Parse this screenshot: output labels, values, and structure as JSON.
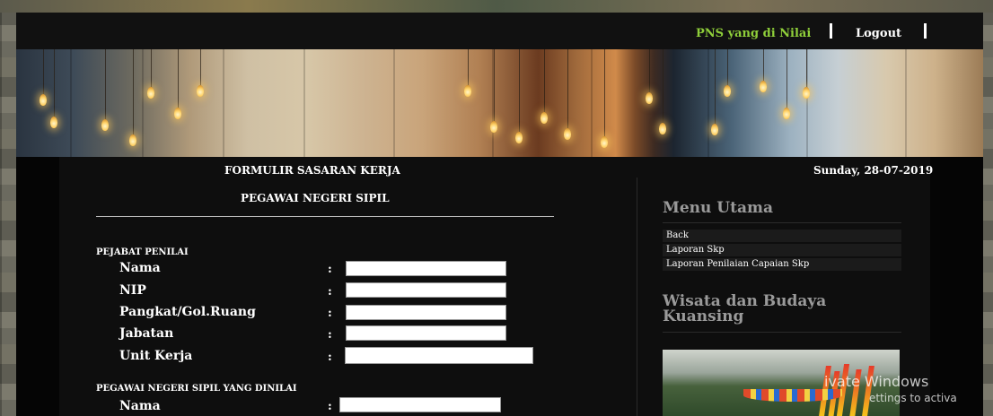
{
  "header": {
    "pns_link": "PNS yang di Nilai",
    "logout_link": "Logout"
  },
  "form": {
    "title_line1": "FORMULIR SASARAN KERJA",
    "title_line2": "PEGAWAI NEGERI SIPIL",
    "date": "Sunday, 28-07-2019",
    "section_penilai": {
      "label": "PEJABAT PENILAI",
      "fields": [
        {
          "label": "Nama",
          "value": ""
        },
        {
          "label": "NIP",
          "value": ""
        },
        {
          "label": "Pangkat/Gol.Ruang",
          "value": ""
        },
        {
          "label": "Jabatan",
          "value": ""
        },
        {
          "label": "Unit Kerja",
          "value": ""
        }
      ]
    },
    "section_dinilai": {
      "label": "PEGAWAI NEGERI SIPIL YANG DINILAI",
      "fields": [
        {
          "label": "Nama",
          "value": ""
        }
      ]
    },
    "colon": ":"
  },
  "sidebar": {
    "menu_heading": "Menu Utama",
    "menu_items": [
      "Back",
      "Laporan Skp",
      "Laporan Penilaian Capaian Skp"
    ],
    "wisata_heading": "Wisata dan Budaya Kuansing"
  },
  "watermark": {
    "line1": "ivate Windows",
    "line2": "ettings to activa"
  },
  "colors": {
    "accent_green": "#8fcf3a",
    "panel_bg": "#0e0e0e"
  }
}
